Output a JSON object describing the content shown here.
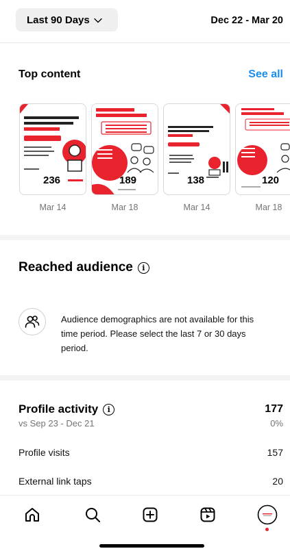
{
  "header": {
    "range_label": "Last 90 Days",
    "date_range": "Dec 22 - Mar 20"
  },
  "top_content": {
    "title": "Top content",
    "see_all": "See all",
    "cards": [
      {
        "count": "236",
        "date": "Mar 14"
      },
      {
        "count": "189",
        "date": "Mar 18"
      },
      {
        "count": "138",
        "date": "Mar 14"
      },
      {
        "count": "120",
        "date": "Mar 18"
      }
    ]
  },
  "reached_audience": {
    "title": "Reached audience",
    "message": "Audience demographics are not available for this time period. Please select the last 7 or 30 days period."
  },
  "profile_activity": {
    "title": "Profile activity",
    "compare": "vs Sep 23 - Dec 21",
    "total": "177",
    "change": "0%",
    "rows": [
      {
        "label": "Profile visits",
        "value": "157"
      },
      {
        "label": "External link taps",
        "value": "20"
      }
    ]
  },
  "colors": {
    "accent": "#1a8cf0",
    "brand_red": "#e8232e",
    "notification_dot": "#e8232e"
  },
  "tabbar": {
    "icons": [
      "home-icon",
      "search-icon",
      "create-icon",
      "reels-icon",
      "profile-avatar"
    ]
  }
}
